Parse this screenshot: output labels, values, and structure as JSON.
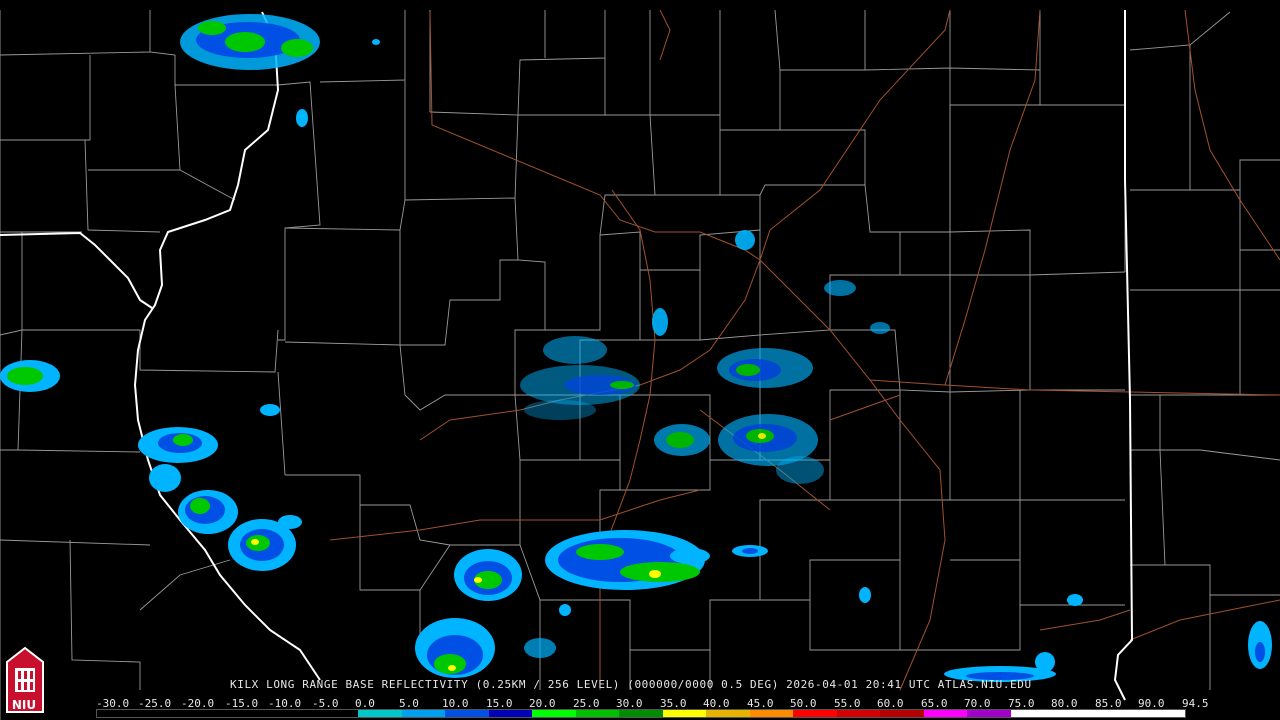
{
  "product": {
    "caption": "KILX LONG RANGE BASE REFLECTIVITY (0.25KM / 256 LEVEL) (000000/0000 0.5 DEG) 2026-04-01 20:41 UTC  ATLAS.NIU.EDU"
  },
  "colorbar": {
    "labels": [
      "-30.0",
      "-25.0",
      "-20.0",
      "-15.0",
      "-10.0",
      "-5.0",
      "0.0",
      "5.0",
      "10.0",
      "15.0",
      "20.0",
      "25.0",
      "30.0",
      "35.0",
      "40.0",
      "45.0",
      "50.0",
      "55.0",
      "60.0",
      "65.0",
      "70.0",
      "75.0",
      "80.0",
      "85.0",
      "90.0",
      "94.5"
    ],
    "colors": [
      "#000000",
      "#000000",
      "#000000",
      "#000000",
      "#000000",
      "#000000",
      "#00c8c8",
      "#00a0f0",
      "#0050e6",
      "#0000b4",
      "#00ff00",
      "#00c000",
      "#008c00",
      "#ffff00",
      "#e6b400",
      "#ff8c00",
      "#ff0000",
      "#d20000",
      "#b40000",
      "#ff00ff",
      "#a000c8",
      "#ffffff",
      "#ffffff",
      "#ffffff",
      "#ffffff"
    ]
  },
  "logo": {
    "text": "NIU",
    "colors": {
      "background": "#c8102e",
      "frame": "#ffffff"
    }
  },
  "map": {
    "colors": {
      "background": "#000000",
      "county_lines": "#a8a8a8",
      "state_lines": "#ffffff",
      "highways": "#a0522d"
    },
    "echo_colors": {
      "weak": "#00c8f0",
      "light": "#0064ff",
      "moderate": "#00e600",
      "heavy": "#ffff00"
    }
  }
}
